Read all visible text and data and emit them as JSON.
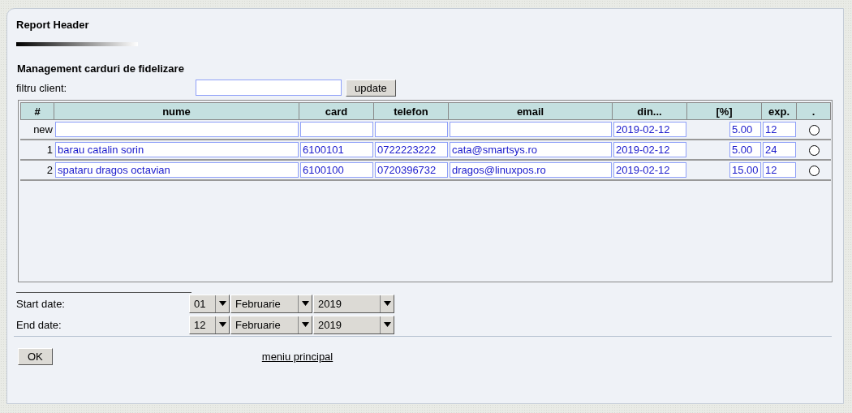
{
  "report_title": "Report Header",
  "section_title": "Management carduri de fidelizare",
  "filter": {
    "label": "filtru client:",
    "button": "update"
  },
  "table": {
    "columns": [
      "#",
      "nume",
      "card",
      "telefon",
      "email",
      "din...",
      "[%]",
      "exp.",
      "."
    ],
    "rows": [
      {
        "number": "new",
        "din": "2019-02-12",
        "pct": "5.00",
        "exp": "12",
        "selected": false
      },
      {
        "number": "1",
        "nume": "barau catalin sorin",
        "card": "6100101",
        "telefon": "0722223222",
        "email": "cata@smartsys.ro",
        "din": "2019-02-12",
        "pct": "5.00",
        "exp": "24",
        "selected": false
      },
      {
        "number": "2",
        "nume": "spataru dragos octavian",
        "card": "6100100",
        "telefon": "0720396732",
        "email": "dragos@linuxpos.ro",
        "din": "2019-02-12",
        "pct": "15.00",
        "exp": "12",
        "selected": false
      }
    ]
  },
  "dates": [
    {
      "label": "Start date:",
      "day": "01",
      "month": "Februarie",
      "year": "2019"
    },
    {
      "label": "End date:",
      "day": "12",
      "month": "Februarie",
      "year": "2019"
    }
  ],
  "ok_button": "OK",
  "main_menu_link": "meniu principal"
}
